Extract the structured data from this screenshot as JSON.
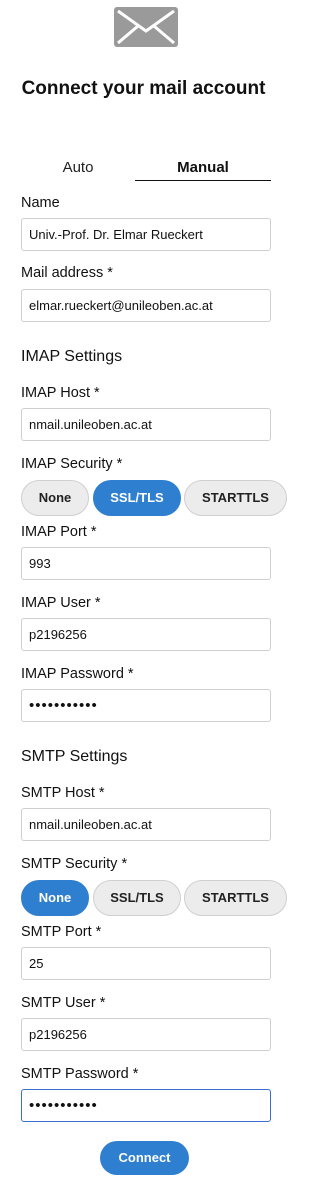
{
  "header": {
    "icon": "mail-icon",
    "title": "Connect your mail account"
  },
  "tabs": {
    "auto": "Auto",
    "manual": "Manual",
    "selected": "Manual"
  },
  "fields": {
    "name": {
      "label": "Name",
      "value": "Univ.-Prof. Dr. Elmar Rueckert"
    },
    "mail_address": {
      "label": "Mail address *",
      "value": "elmar.rueckert@unileoben.ac.at"
    }
  },
  "imap": {
    "section_title": "IMAP Settings",
    "host": {
      "label": "IMAP Host *",
      "value": "nmail.unileoben.ac.at"
    },
    "security": {
      "label": "IMAP Security *",
      "options": [
        "None",
        "SSL/TLS",
        "STARTTLS"
      ],
      "selected": "SSL/TLS"
    },
    "port": {
      "label": "IMAP Port *",
      "value": "993"
    },
    "user": {
      "label": "IMAP User *",
      "value": "p2196256"
    },
    "password": {
      "label": "IMAP Password *",
      "value": "•••••••••••"
    }
  },
  "smtp": {
    "section_title": "SMTP Settings",
    "host": {
      "label": "SMTP Host *",
      "value": "nmail.unileoben.ac.at"
    },
    "security": {
      "label": "SMTP Security *",
      "options": [
        "None",
        "SSL/TLS",
        "STARTTLS"
      ],
      "selected": "None"
    },
    "port": {
      "label": "SMTP Port *",
      "value": "25"
    },
    "user": {
      "label": "SMTP User *",
      "value": "p2196256"
    },
    "password": {
      "label": "SMTP Password *",
      "value": "•••••••••••"
    }
  },
  "actions": {
    "connect": "Connect"
  },
  "colors": {
    "accent": "#2f7fd0",
    "icon_gray": "#9a9a9a"
  }
}
